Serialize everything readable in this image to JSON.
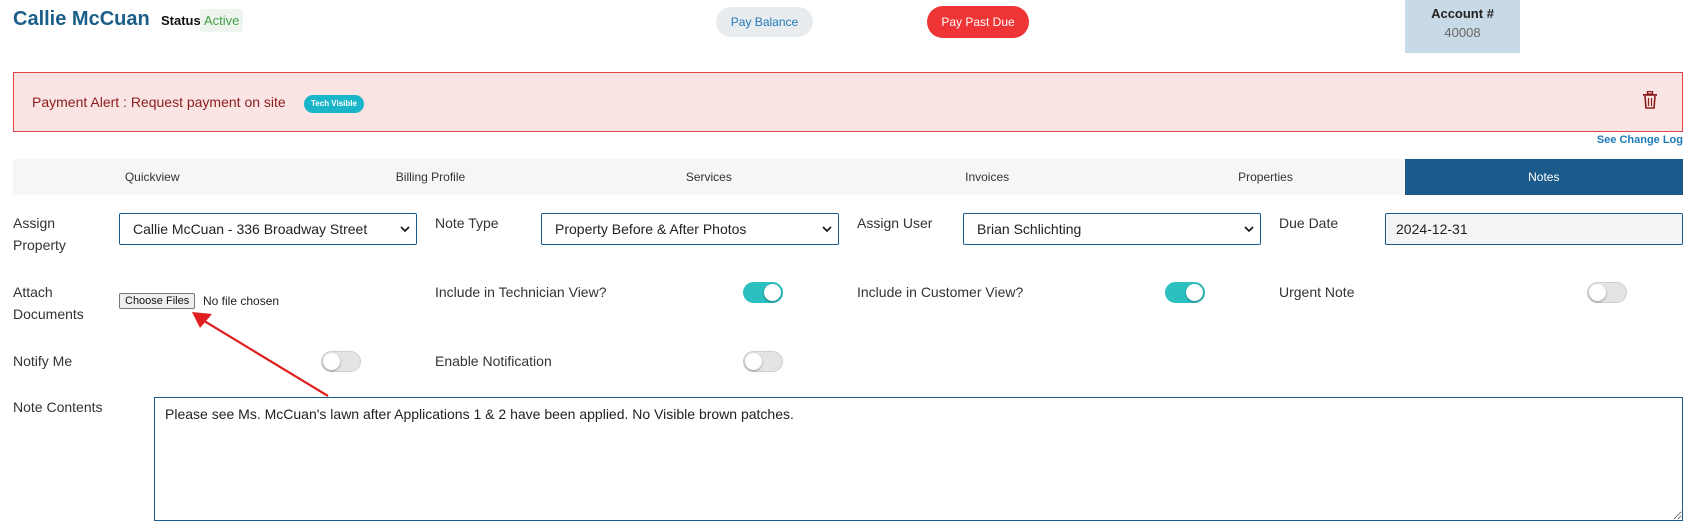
{
  "header": {
    "customer_name": "Callie McCuan",
    "status_label": "Status",
    "status_value": "Active",
    "pay_balance": "Pay Balance",
    "pay_past_due": "Pay Past Due",
    "account_title": "Account #",
    "account_number": "40008"
  },
  "alert": {
    "text": "Payment Alert : Request payment on site",
    "badge": "Tech Visible",
    "delete_icon": "trash-icon"
  },
  "change_log": "See Change Log",
  "tabs": [
    {
      "label": "Quickview"
    },
    {
      "label": "Billing Profile"
    },
    {
      "label": "Services"
    },
    {
      "label": "Invoices"
    },
    {
      "label": "Properties"
    },
    {
      "label": "Notes",
      "active": true
    }
  ],
  "form": {
    "assign_property": {
      "label": "Assign Property",
      "value": "Callie McCuan - 336 Broadway Street"
    },
    "note_type": {
      "label": "Note Type",
      "value": "Property Before & After Photos"
    },
    "assign_user": {
      "label": "Assign User",
      "value": "Brian Schlichting"
    },
    "due_date": {
      "label": "Due Date",
      "value": "2024-12-31"
    },
    "attach_documents": {
      "label": "Attach Documents",
      "button": "Choose Files",
      "status": "No file chosen"
    },
    "include_technician": {
      "label": "Include in Technician View?",
      "on": true
    },
    "include_customer": {
      "label": "Include in Customer View?",
      "on": true
    },
    "urgent_note": {
      "label": "Urgent Note",
      "on": false
    },
    "notify_me": {
      "label": "Notify Me",
      "on": false
    },
    "enable_notification": {
      "label": "Enable Notification",
      "on": false
    },
    "note_contents": {
      "label": "Note Contents",
      "value": "Please see Ms. McCuan's lawn after Applications 1 & 2 have been applied. No Visible brown patches."
    }
  },
  "colors": {
    "brand": "#1b5a8a",
    "toggle_on": "#2bbfbf",
    "danger": "#ee3434",
    "annotation_arrow": "#e02020"
  }
}
